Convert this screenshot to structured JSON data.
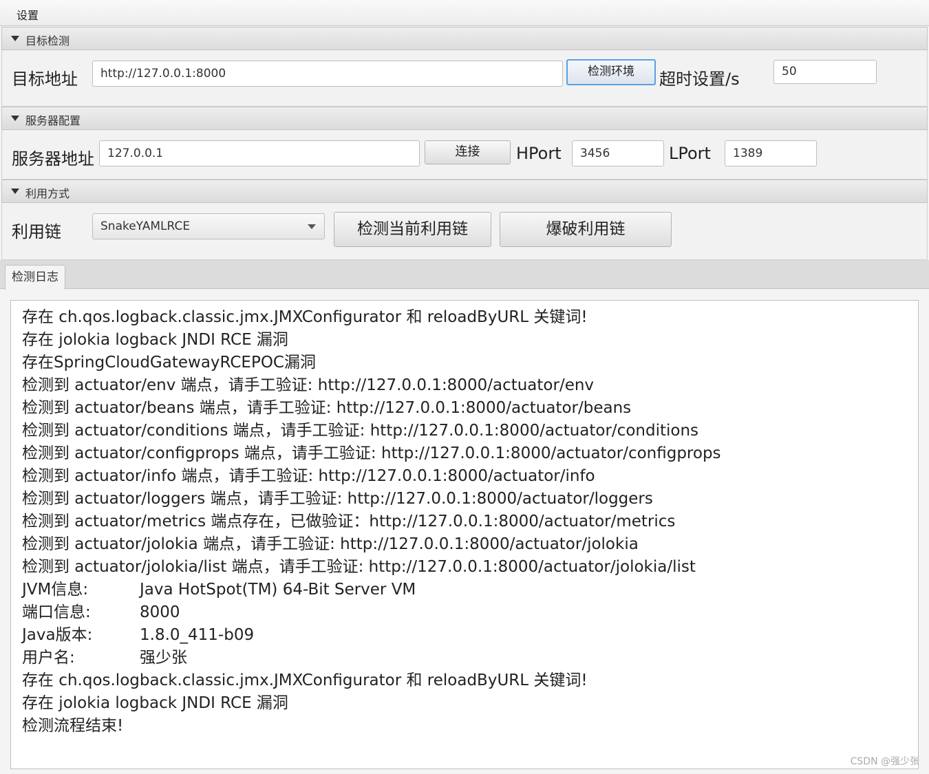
{
  "menu": {
    "settings": "设置"
  },
  "target_section": {
    "title": "目标检测",
    "address_label": "目标地址",
    "address_value": "http://127.0.0.1:8000",
    "detect_button": "检测环境",
    "timeout_label": "超时设置/s",
    "timeout_value": "50"
  },
  "server_section": {
    "title": "服务器配置",
    "address_label": "服务器地址",
    "address_value": "127.0.0.1",
    "connect_button": "连接",
    "hport_label": "HPort",
    "hport_value": "3456",
    "lport_label": "LPort",
    "lport_value": "1389"
  },
  "exploit_section": {
    "title": "利用方式",
    "chain_label": "利用链",
    "chain_selected": "SnakeYAMLRCE",
    "detect_chain_button": "检测当前利用链",
    "brute_chain_button": "爆破利用链"
  },
  "log_tab": {
    "label": "检测日志"
  },
  "log_lines": [
    "存在 ch.qos.logback.classic.jmx.JMXConfigurator 和 reloadByURL 关键词!",
    "存在 jolokia logback JNDI RCE 漏洞",
    "存在SpringCloudGatewayRCEPOC漏洞",
    "检测到 actuator/env 端点，请手工验证: http://127.0.0.1:8000/actuator/env",
    "检测到 actuator/beans 端点，请手工验证: http://127.0.0.1:8000/actuator/beans",
    "检测到 actuator/conditions 端点，请手工验证: http://127.0.0.1:8000/actuator/conditions",
    "检测到 actuator/configprops 端点，请手工验证: http://127.0.0.1:8000/actuator/configprops",
    "检测到 actuator/info 端点，请手工验证: http://127.0.0.1:8000/actuator/info",
    "检测到 actuator/loggers 端点，请手工验证: http://127.0.0.1:8000/actuator/loggers",
    "检测到 actuator/metrics 端点存在，已做验证：http://127.0.0.1:8000/actuator/metrics",
    "检测到 actuator/jolokia 端点，请手工验证: http://127.0.0.1:8000/actuator/jolokia",
    "检测到 actuator/jolokia/list 端点，请手工验证: http://127.0.0.1:8000/actuator/jolokia/list"
  ],
  "info_lines": [
    {
      "key": "JVM信息:",
      "value": "Java HotSpot(TM) 64-Bit Server VM"
    },
    {
      "key": "端口信息:",
      "value": "8000"
    },
    {
      "key": "Java版本:",
      "value": "1.8.0_411-b09"
    },
    {
      "key": "用户名:",
      "value": "强少张"
    }
  ],
  "log_tail": [
    "存在 ch.qos.logback.classic.jmx.JMXConfigurator 和 reloadByURL 关键词!",
    "存在 jolokia logback JNDI RCE 漏洞",
    "检测流程结束!"
  ],
  "watermark": "CSDN @强少张"
}
